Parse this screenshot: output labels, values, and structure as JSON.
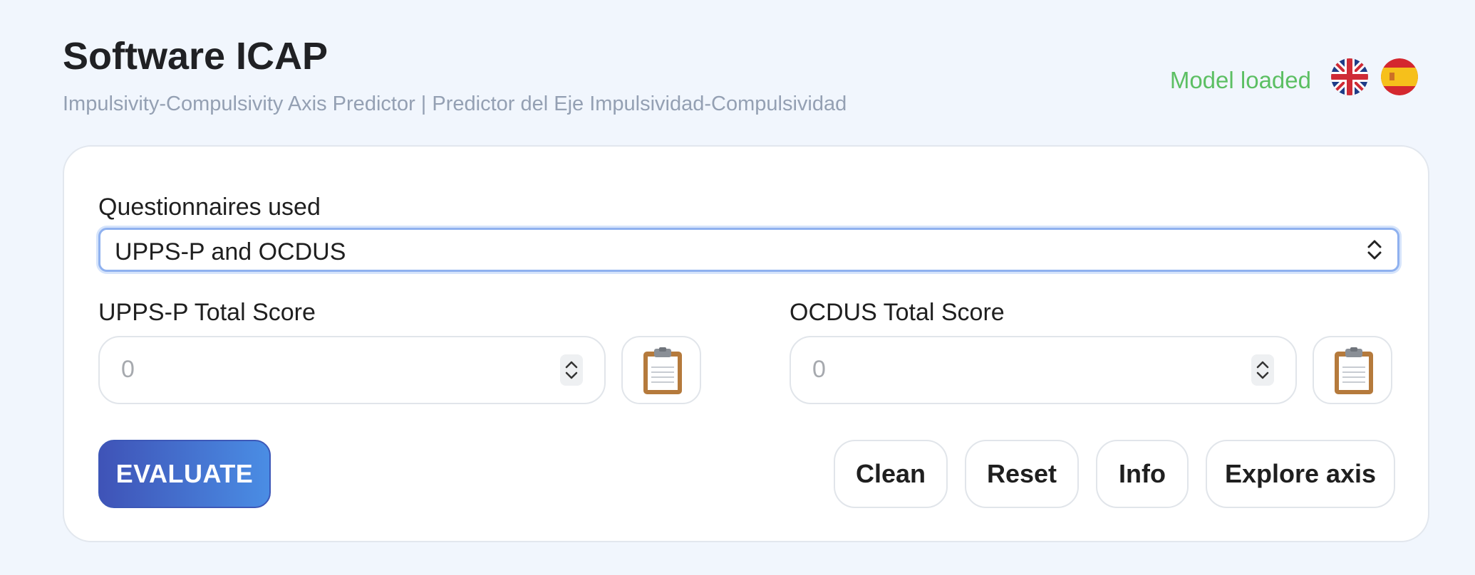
{
  "header": {
    "title": "Software ICAP",
    "subtitle": "Impulsivity-Compulsivity Axis Predictor | Predictor del Eje Impulsividad-Compulsividad",
    "status": "Model loaded",
    "status_color": "#5cbf63"
  },
  "languages": [
    {
      "icon": "uk-flag-icon"
    },
    {
      "icon": "spain-flag-icon"
    }
  ],
  "form": {
    "questionnaire_label": "Questionnaires used",
    "questionnaire_selected": "UPPS-P and OCDUS",
    "upps": {
      "label": "UPPS-P Total Score",
      "placeholder": "0"
    },
    "ocdus": {
      "label": "OCDUS Total Score",
      "placeholder": "0"
    }
  },
  "actions": {
    "evaluate": "EVALUATE",
    "clean": "Clean",
    "reset": "Reset",
    "info": "Info",
    "explore": "Explore axis"
  },
  "colors": {
    "background": "#f1f6fd",
    "accent_start": "#3f53b7",
    "accent_end": "#4a8de4",
    "focus_border": "#8fb1ef"
  }
}
